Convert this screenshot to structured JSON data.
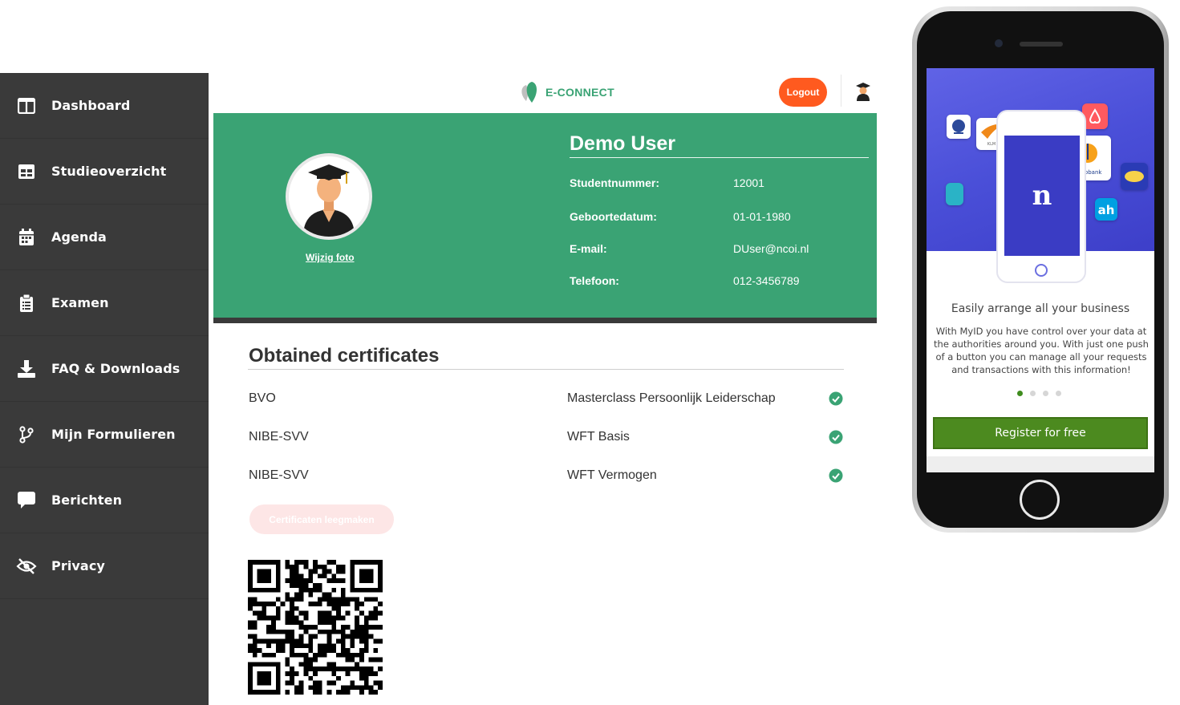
{
  "sidebar": {
    "items": [
      {
        "label": "Dashboard",
        "icon": "dashboard-icon"
      },
      {
        "label": "Studieoverzicht",
        "icon": "table-icon"
      },
      {
        "label": "Agenda",
        "icon": "calendar-icon"
      },
      {
        "label": "Examen",
        "icon": "clipboard-icon"
      },
      {
        "label": "FAQ & Downloads",
        "icon": "download-icon"
      },
      {
        "label": "Mijn Formulieren",
        "icon": "branch-icon"
      },
      {
        "label": "Berichten",
        "icon": "chat-icon"
      },
      {
        "label": "Privacy",
        "icon": "eye-slash-icon"
      }
    ]
  },
  "header": {
    "brand": "E-CONNECT",
    "logout_label": "Logout"
  },
  "profile": {
    "name": "Demo User",
    "change_photo_label": "Wijzig foto",
    "fields": [
      {
        "label": "Studentnummer:",
        "value": "12001"
      },
      {
        "label": "Geboortedatum:",
        "value": "01-01-1980"
      },
      {
        "label": "E-mail:",
        "value": "DUser@ncoi.nl"
      },
      {
        "label": "Telefoon:",
        "value": "012-3456789"
      }
    ]
  },
  "certificates": {
    "title": "Obtained certificates",
    "rows": [
      {
        "org": "BVO",
        "name": "Masterclass Persoonlijk Leiderschap"
      },
      {
        "org": "NIBE-SVV",
        "name": "WFT Basis"
      },
      {
        "org": "NIBE-SVV",
        "name": "WFT Vermogen"
      }
    ],
    "clear_label": "Certificaten leegmaken"
  },
  "phone": {
    "title": "Easily arrange all your business",
    "text": "With MyID you have control over your data at the authorities around you. With just one push of a button you can manage all your requests and transactions with this information!",
    "register_label": "Register for free",
    "app_labels": {
      "klm": "KLM",
      "rabobank": "Rabobank",
      "ah": "ah",
      "myid": "n"
    }
  },
  "colors": {
    "sidebar": "#3a3a3a",
    "brand_green": "#3aa374",
    "logout_orange": "#ff5a1f",
    "register_green": "#4c8a1f"
  }
}
